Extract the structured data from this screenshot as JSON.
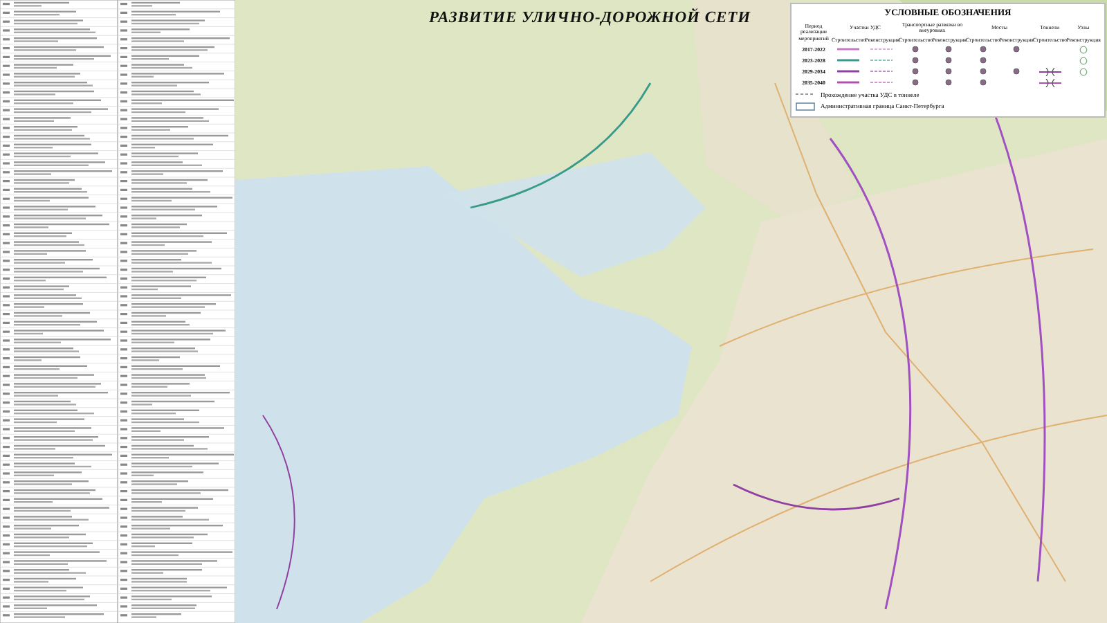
{
  "title": "РАЗВИТИЕ УЛИЧНО-ДОРОЖНОЙ СЕТИ",
  "legend": {
    "title": "УСЛОВНЫЕ ОБОЗНАЧЕНИЯ",
    "period_header": "Период реализации мероприятий",
    "groups": [
      {
        "label": "Участки УДС",
        "columns": [
          {
            "label": "Строительство",
            "kind": "line"
          },
          {
            "label": "Реконструкция",
            "kind": "dash"
          }
        ]
      },
      {
        "label": "Транспортные развязки во внеуровнях",
        "columns": [
          {
            "label": "Строительство",
            "kind": "dot"
          },
          {
            "label": "Реконструкция",
            "kind": "dot"
          }
        ]
      },
      {
        "label": "Мосты",
        "columns": [
          {
            "label": "Строительство",
            "kind": "dot"
          },
          {
            "label": "Реконструкция",
            "kind": "dot"
          }
        ]
      },
      {
        "label": "Тоннели",
        "columns": [
          {
            "label": "Строительство",
            "kind": "tunnel"
          }
        ]
      },
      {
        "label": "Узлы",
        "columns": [
          {
            "label": "Реконструкция",
            "kind": "ring"
          }
        ]
      }
    ],
    "periods": [
      {
        "label": "2017-2022",
        "color": "#c878c8",
        "marks": [
          true,
          true,
          true,
          true,
          true,
          true,
          false,
          true
        ]
      },
      {
        "label": "2023-2028",
        "color": "#3a9a8a",
        "marks": [
          true,
          true,
          true,
          true,
          true,
          false,
          false,
          true
        ]
      },
      {
        "label": "2029-2034",
        "color": "#9040a0",
        "marks": [
          true,
          true,
          true,
          true,
          true,
          true,
          true,
          true
        ]
      },
      {
        "label": "2035-2040",
        "color": "#b050b0",
        "marks": [
          true,
          true,
          true,
          true,
          true,
          false,
          true,
          false
        ]
      }
    ],
    "notes": [
      {
        "kind": "dashed",
        "text": "Прохождение участка УДС в тоннеле"
      },
      {
        "kind": "border",
        "text": "Административная граница Санкт-Петербурга"
      }
    ]
  }
}
